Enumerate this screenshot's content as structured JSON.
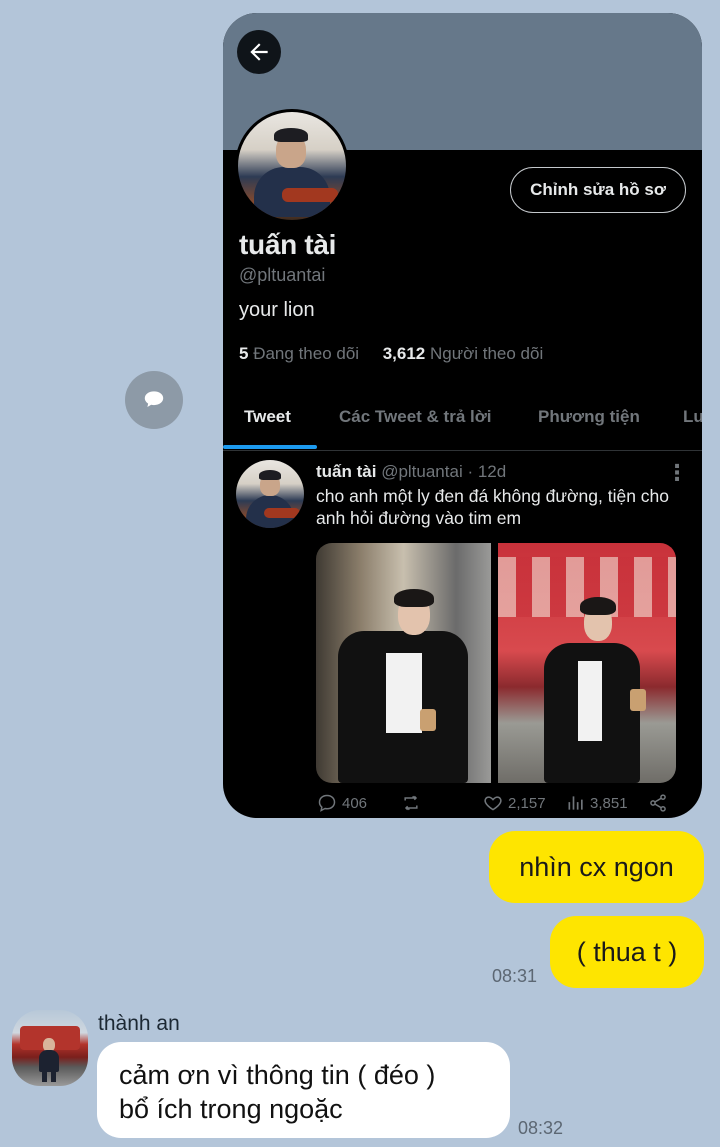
{
  "twitter_profile": {
    "edit_button": "Chỉnh sửa hồ sơ",
    "name": "tuấn tài",
    "handle": "@pltuantai",
    "bio": "your lion",
    "following_count": "5",
    "following_label": "Đang theo dõi",
    "followers_count": "3,612",
    "followers_label": "Người theo dõi",
    "tabs": [
      {
        "label": "Tweet",
        "active": true
      },
      {
        "label": "Các Tweet & trả lời",
        "active": false
      },
      {
        "label": "Phương tiện",
        "active": false
      },
      {
        "label": "Lu",
        "active": false
      }
    ],
    "accent_color": "#1d9bf0",
    "tweet": {
      "author": "tuấn tài",
      "handle": "@pltuantai",
      "age": "· 12d",
      "text": "cho anh một ly đen đá không đường, tiện cho anh hỏi đường vào tim em",
      "replies": "406",
      "likes": "2,157",
      "views": "3,851"
    }
  },
  "chat": {
    "outgoing": [
      {
        "text": "nhìn cx ngon"
      },
      {
        "text": "( thua t )"
      }
    ],
    "outgoing_time": "08:31",
    "incoming": {
      "sender": "thành an",
      "text_line1": "cảm ơn vì thông tin ( đéo )",
      "text_line2": "bổ ích trong ngoặc",
      "time": "08:32"
    },
    "bubble_color": "#fee500",
    "background_color": "#b3c5d9"
  }
}
